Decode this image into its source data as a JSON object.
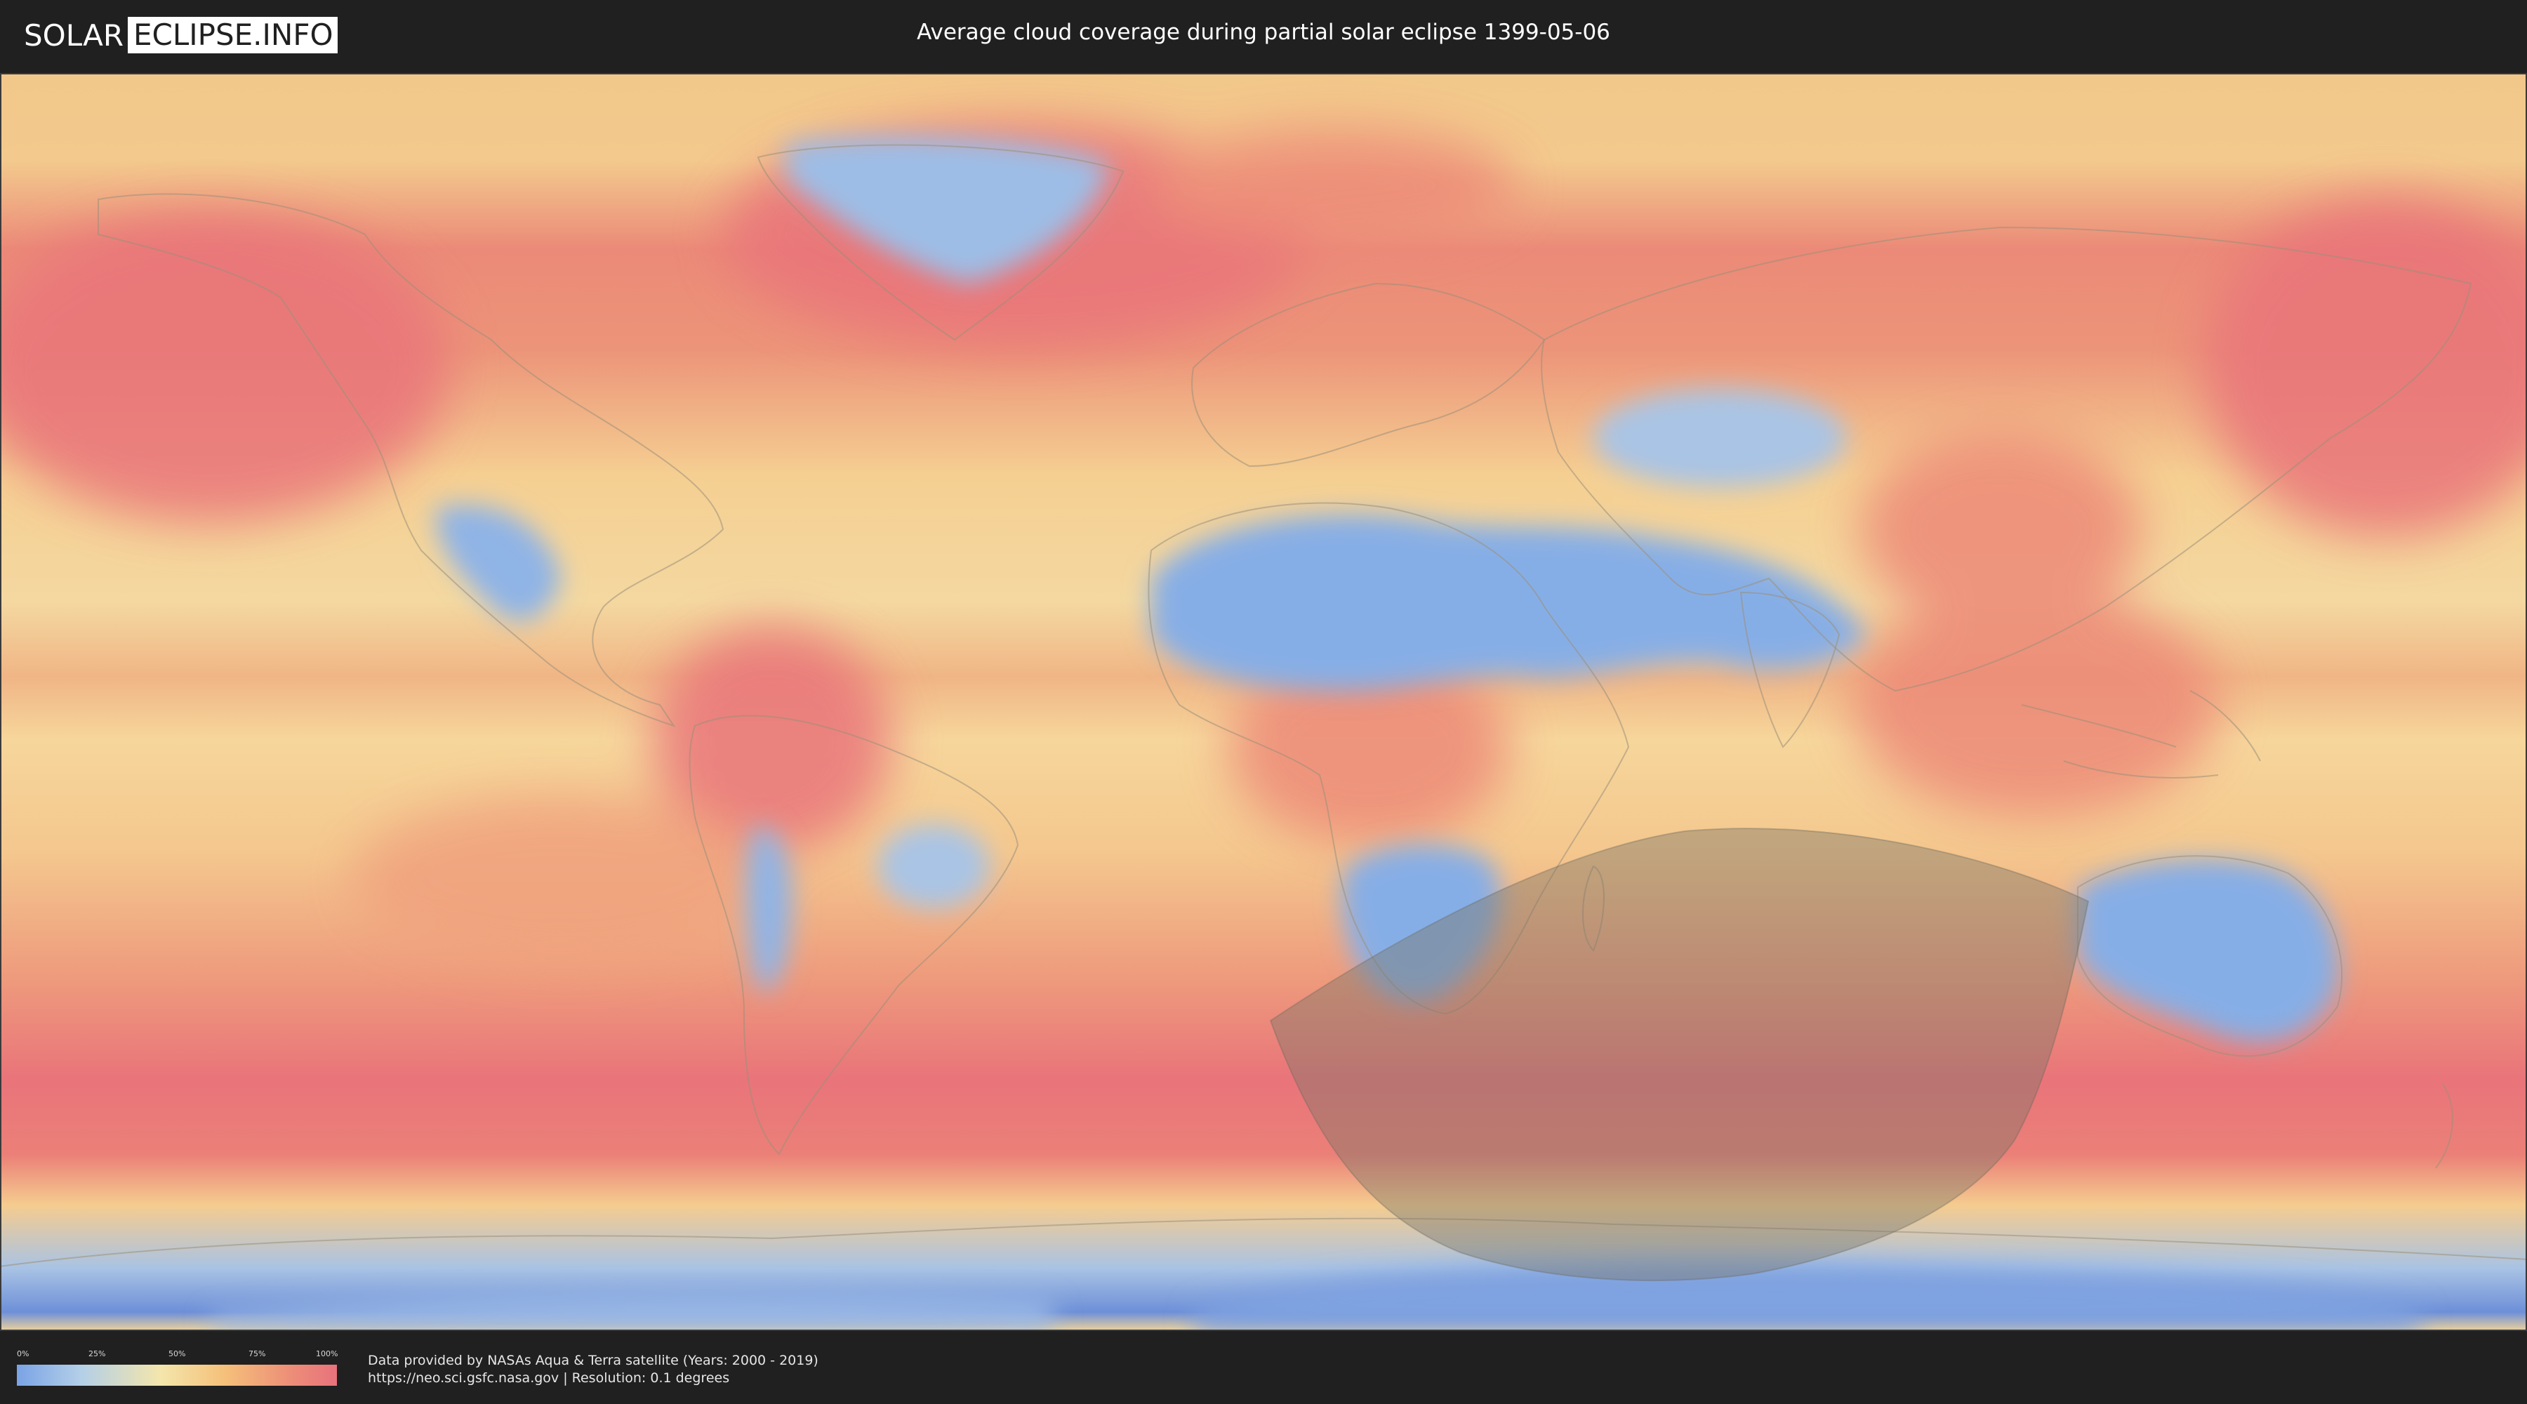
{
  "header": {
    "logo_left": "SOLAR",
    "logo_right": "ECLIPSE.INFO",
    "title": "Average cloud coverage during partial solar eclipse 1399-05-06"
  },
  "legend": {
    "ticks": [
      "0%",
      "25%",
      "50%",
      "75%",
      "100%"
    ],
    "colors": {
      "low": "#7aa3e5",
      "mid": "#f4e6ab",
      "high": "#e8727c"
    }
  },
  "credits": {
    "line1": "Data provided by NASAs Aqua & Terra satellite (Years: 2000 - 2019)",
    "line2": "https://neo.sci.gsfc.nasa.gov | Resolution: 0.1 degrees"
  },
  "map": {
    "projection": "equirectangular",
    "eclipse_visibility_zone": "shaded",
    "colors": {
      "ocean_cloudy": "#e9757a",
      "ocean_moderate": "#f4c488",
      "land_clear": "#86aee6",
      "shadow": "#7a7466"
    }
  }
}
